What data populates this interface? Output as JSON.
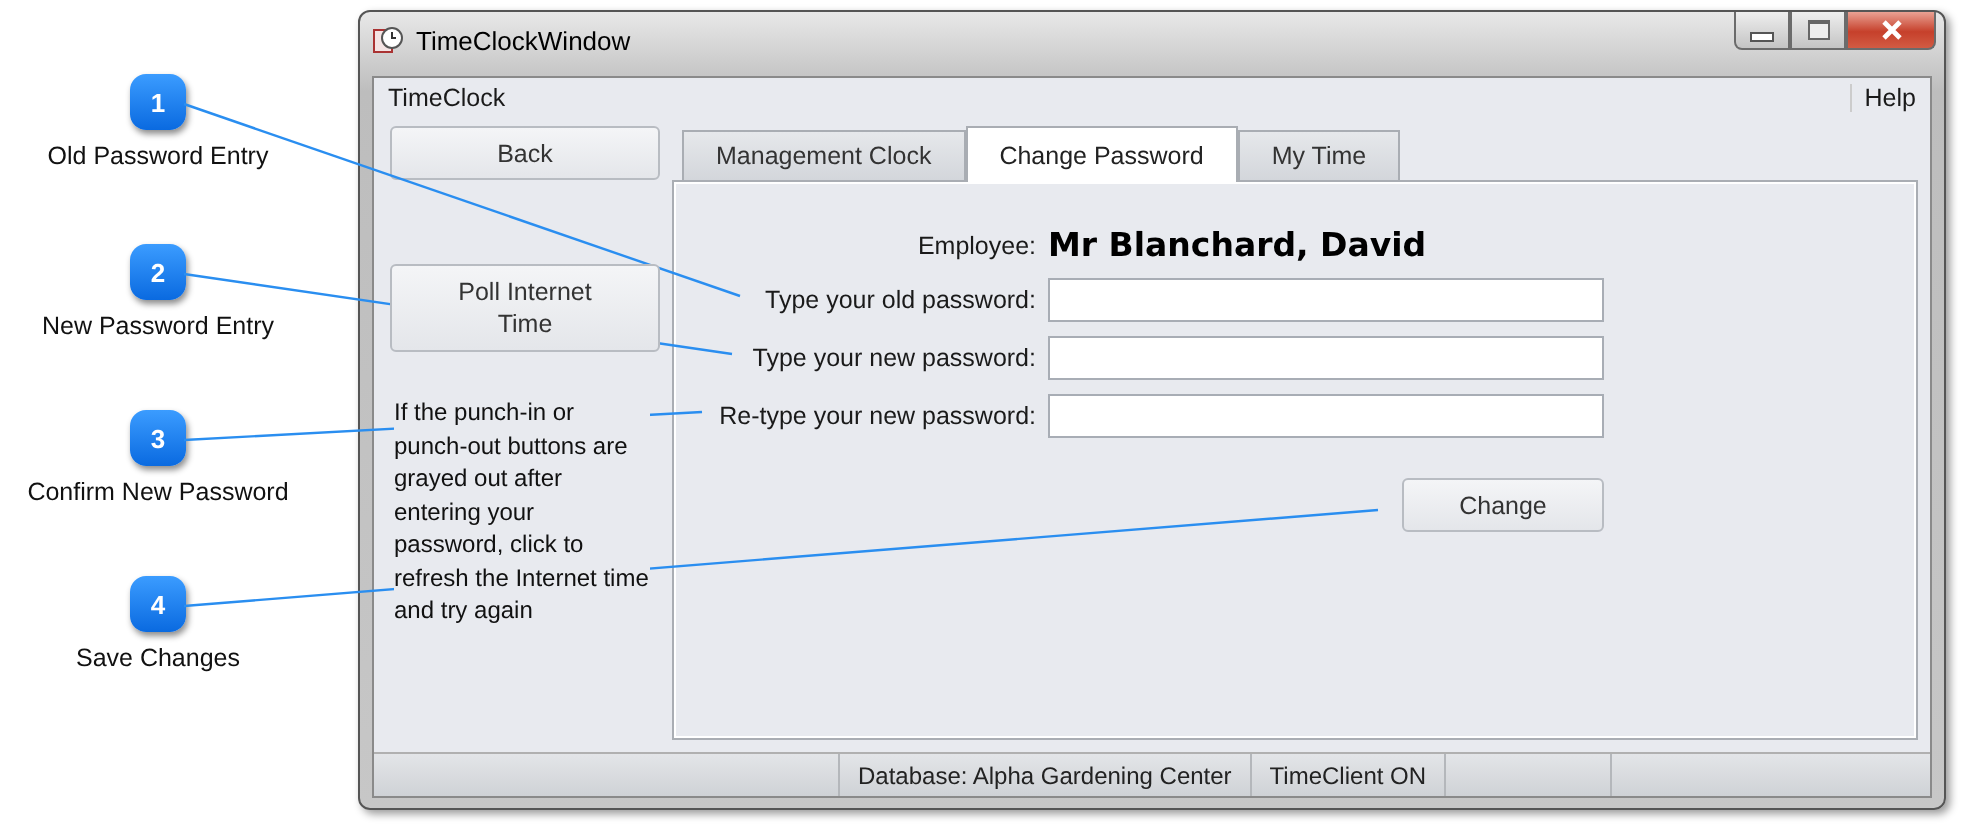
{
  "callouts": [
    {
      "number": "1",
      "label": "Old Password Entry"
    },
    {
      "number": "2",
      "label": "New Password Entry"
    },
    {
      "number": "3",
      "label": "Confirm New Password"
    },
    {
      "number": "4",
      "label": "Save Changes"
    }
  ],
  "window": {
    "title": "TimeClockWindow"
  },
  "menu": {
    "left": "TimeClock",
    "right": "Help"
  },
  "sidebar": {
    "buttons": [
      "Back",
      "Poll Internet Time"
    ],
    "note": "If the punch-in or punch-out buttons are grayed out after entering your password, click to refresh the Internet time and try again"
  },
  "tabs": [
    {
      "label": "Management Clock",
      "selected": false
    },
    {
      "label": "Change Password",
      "selected": true
    },
    {
      "label": "My Time",
      "selected": false
    }
  ],
  "form": {
    "employee_label": "Employee:",
    "employee_name": "Mr Blanchard, David",
    "fields": [
      {
        "label": "Type your old password:"
      },
      {
        "label": "Type your new password:"
      },
      {
        "label": "Re-type your new password:"
      }
    ],
    "button": "Change"
  },
  "status_bar": [
    "Database: Alpha Gardening Center",
    "TimeClient ON"
  ]
}
